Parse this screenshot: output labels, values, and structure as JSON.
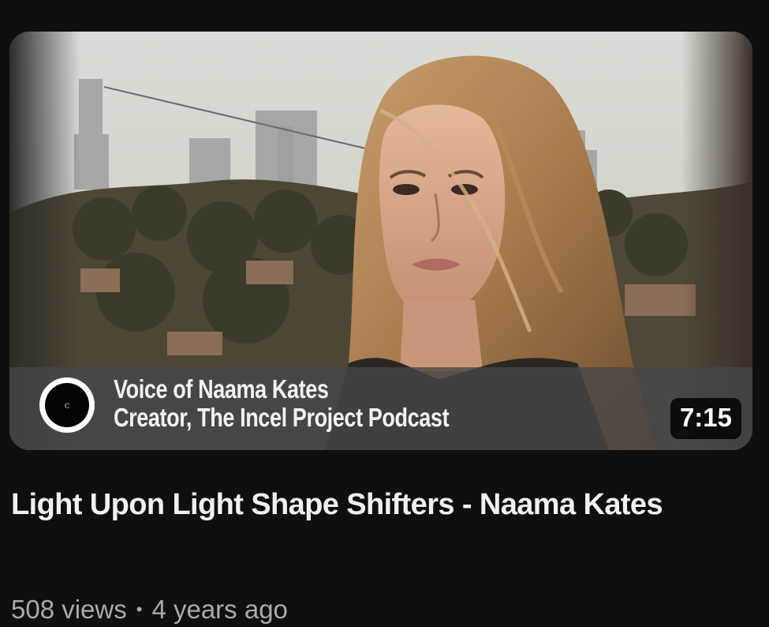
{
  "video": {
    "thumbnail": {
      "caption_line1": "Voice of Naama Kates",
      "caption_line2": "Creator, The Incel Project Podcast",
      "logo_letter": "c",
      "duration": "7:15"
    },
    "title": "Light Upon Light Shape Shifters - Naama Kates",
    "views": "508 views",
    "separator": "•",
    "age": "4 years ago"
  },
  "colors": {
    "background": "#0f0f0f",
    "title_text": "#f1f1f1",
    "meta_text": "#aaaaaa",
    "badge_bg": "#000000"
  }
}
